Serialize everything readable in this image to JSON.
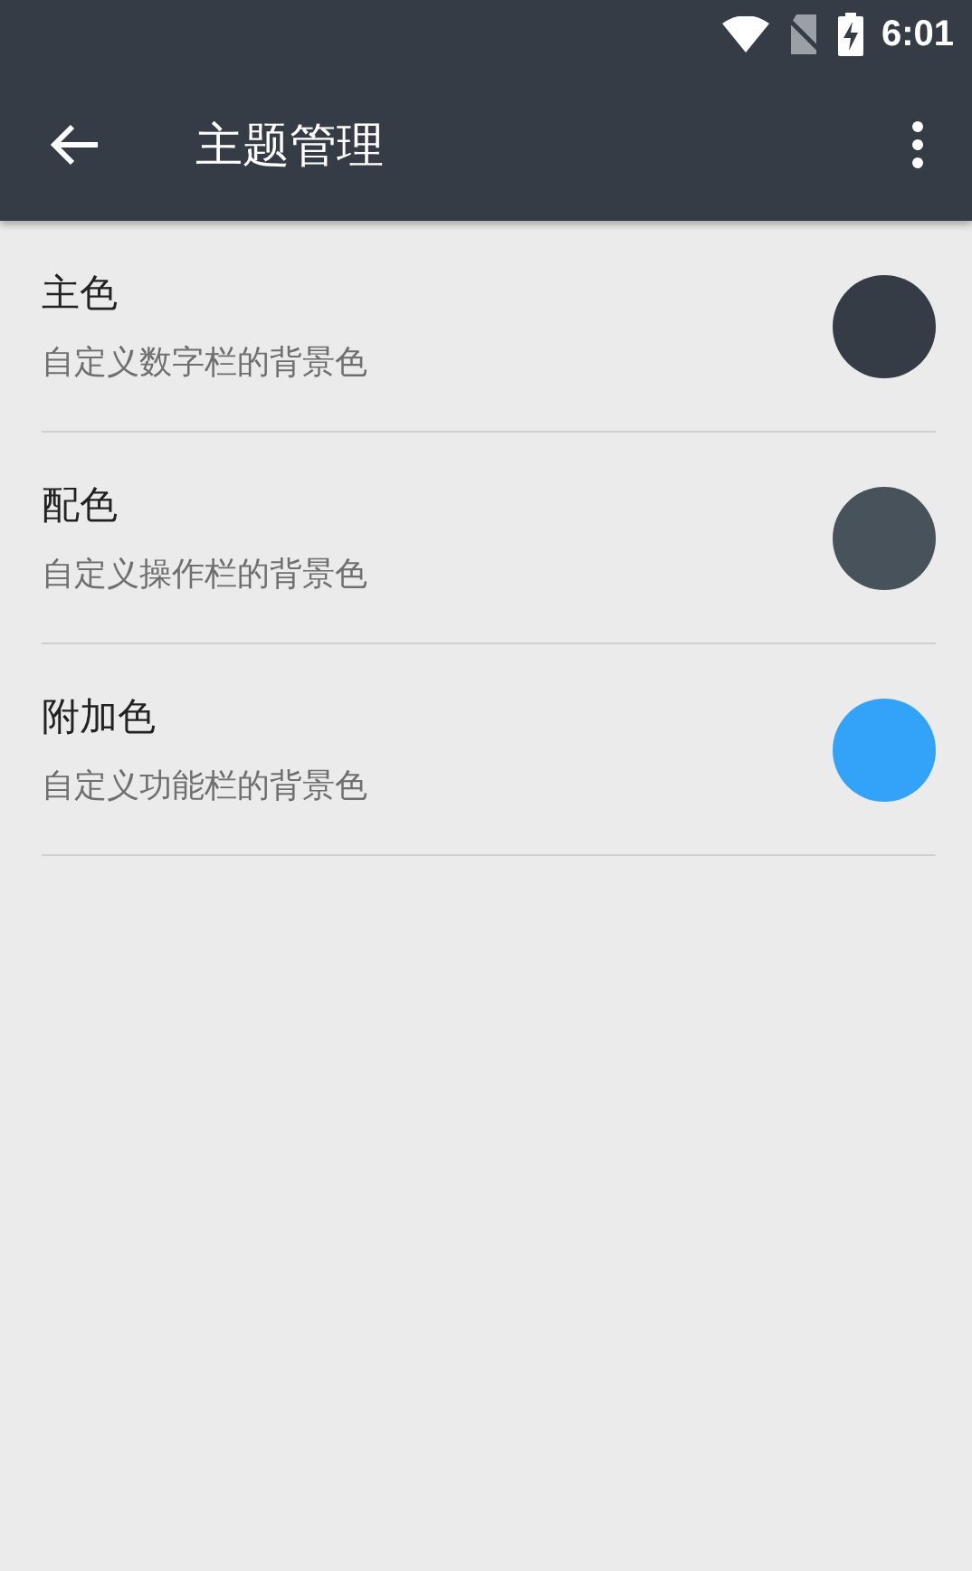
{
  "status_bar": {
    "time": "6:01"
  },
  "toolbar": {
    "title": "主题管理"
  },
  "items": [
    {
      "title": "主色",
      "subtitle": "自定义数字栏的背景色",
      "color": "#353c45"
    },
    {
      "title": "配色",
      "subtitle": "自定义操作栏的背景色",
      "color": "#48525a"
    },
    {
      "title": "附加色",
      "subtitle": "自定义功能栏的背景色",
      "color": "#33a3fa"
    }
  ]
}
